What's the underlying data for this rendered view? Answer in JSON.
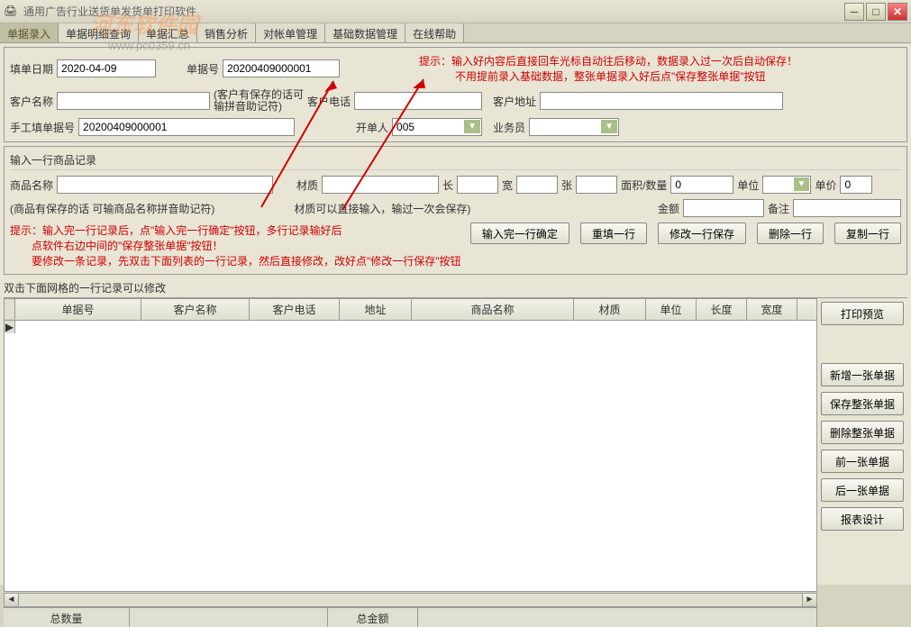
{
  "window": {
    "title": "通用广告行业送货单发货单打印软件"
  },
  "tabs": {
    "t1": "单据录入",
    "t2": "单据明细查询",
    "t3": "单据汇总",
    "t4": "销售分析",
    "t5": "对帐单管理",
    "t6": "基础数据管理",
    "t7": "在线帮助"
  },
  "header": {
    "fill_date_label": "填单日期",
    "fill_date_value": "2020-04-09",
    "doc_no_label": "单据号",
    "doc_no_value": "20200409000001",
    "hint1": "提示：输入好内容后直接回车光标自动往后移动，数据录入过一次后自动保存！",
    "hint2": "不用提前录入基础数据，整张单据录入好后点\"保存整张单据\"按钮",
    "customer_label": "客户名称",
    "customer_paren": "(客户有保存的话可输拼音助记符)",
    "phone_label": "客户电话",
    "address_label": "客户地址",
    "manual_no_label": "手工填单据号",
    "manual_no_value": "20200409000001",
    "operator_label": "开单人",
    "operator_value": "005",
    "sales_label": "业务员"
  },
  "product": {
    "section_title": "输入一行商品记录",
    "name_label": "商品名称",
    "material_label": "材质",
    "length_label": "长",
    "width_label": "宽",
    "count_label": "张",
    "area_qty_label": "面积/数量",
    "area_qty_value": "0",
    "unit_label": "单位",
    "price_label": "单价",
    "price_value": "0",
    "paren_hint": "(商品有保存的话  可输商品名称拼音助记符)",
    "material_hint": "材质可以直接输入，输过一次会保存)",
    "amount_label": "金额",
    "remark_label": "备注",
    "tip1": "提示：输入完一行记录后，点\"输入完一行确定\"按钮，多行记录输好后",
    "tip2": "点软件右边中间的\"保存整张单据\"按钮！",
    "tip3": "要修改一条记录，先双击下面列表的一行记录，然后直接修改，改好点\"修改一行保存\"按钮"
  },
  "buttons": {
    "confirm_line": "输入完一行确定",
    "refill": "重填一行",
    "modify_save": "修改一行保存",
    "delete_line": "删除一行",
    "copy_line": "复制一行",
    "print_preview": "打印预览",
    "new_doc": "新增一张单据",
    "save_doc": "保存整张单据",
    "delete_doc": "删除整张单据",
    "prev_doc": "前一张单据",
    "next_doc": "后一张单据",
    "report_design": "报表设计"
  },
  "grid": {
    "title": "双击下面网格的一行记录可以修改",
    "cols": {
      "c1": "单据号",
      "c2": "客户名称",
      "c3": "客户电话",
      "c4": "地址",
      "c5": "商品名称",
      "c6": "材质",
      "c7": "单位",
      "c8": "长度",
      "c9": "宽度"
    }
  },
  "footer": {
    "total_qty": "总数量",
    "total_amount": "总金额"
  },
  "watermark": {
    "brand": "河东软件园",
    "url": "www.pc0359.cn"
  }
}
